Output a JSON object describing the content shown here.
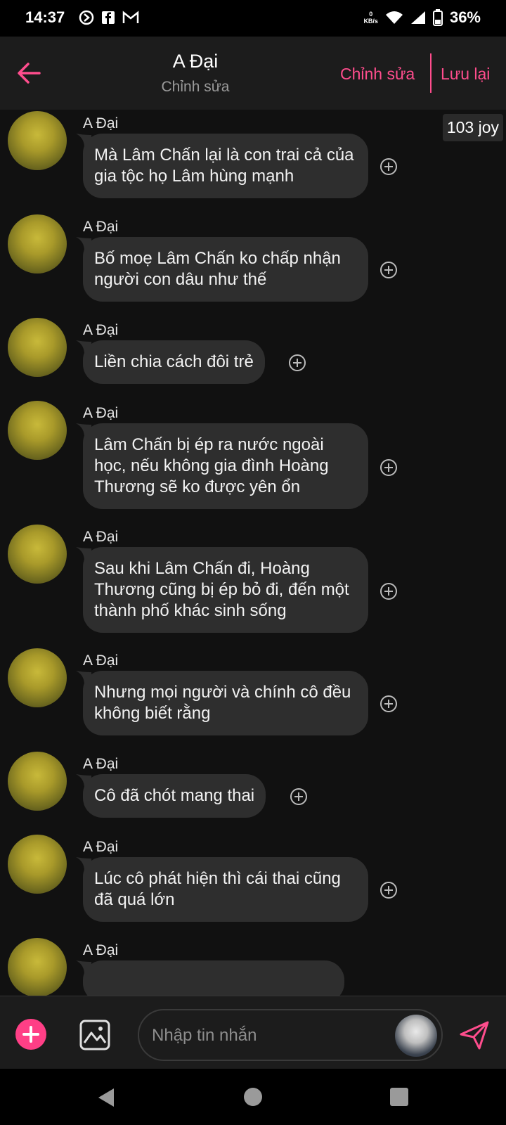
{
  "status_bar": {
    "time": "14:37",
    "net_speed_value": "0",
    "net_speed_unit": "KB/s",
    "battery": "36%"
  },
  "header": {
    "title": "A Đại",
    "subtitle": "Chỉnh sửa",
    "edit_label": "Chỉnh sửa",
    "save_label": "Lưu lại"
  },
  "joy_badge": "103 joy",
  "messages": [
    {
      "sender": "A Đại",
      "text": "Mà Lâm Chấn lại là con trai cả của gia tộc họ Lâm hùng mạnh"
    },
    {
      "sender": "A Đại",
      "text": "Bố moẹ Lâm Chấn ko chấp nhận người con dâu như thế"
    },
    {
      "sender": "A Đại",
      "text": "Liền chia cách đôi trẻ"
    },
    {
      "sender": "A Đại",
      "text": "Lâm Chấn bị ép ra nước ngoài học, nếu không gia đình Hoàng Thương sẽ ko được yên ổn"
    },
    {
      "sender": "A Đại",
      "text": "Sau khi Lâm Chấn đi, Hoàng Thương cũng bị ép bỏ đi, đến một thành phố khác sinh sống"
    },
    {
      "sender": "A Đại",
      "text": "Nhưng mọi người và chính cô đều không biết rằng"
    },
    {
      "sender": "A Đại",
      "text": "Cô đã chót mang thai"
    },
    {
      "sender": "A Đại",
      "text": "Lúc cô phát hiện thì cái thai cũng đã quá lớn"
    },
    {
      "sender": "A Đại",
      "text": ""
    }
  ],
  "input": {
    "placeholder": "Nhập tin nhắn"
  },
  "colors": {
    "accent": "#ff4d8d",
    "bubble": "#2e2e2e",
    "background": "#111111"
  }
}
